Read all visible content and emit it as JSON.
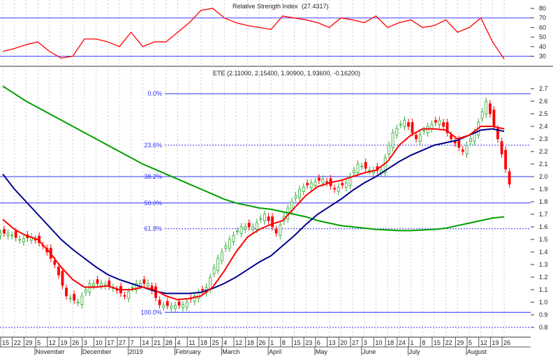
{
  "chart_data": [
    {
      "type": "line",
      "title": "Relative Strength Index",
      "title_value": "(27.4317)",
      "y_ticks": [
        30,
        40,
        50,
        60,
        70,
        80
      ],
      "ylim": [
        25,
        85
      ],
      "reference_lines": [
        70,
        30
      ],
      "color": "#ff0000",
      "values": [
        35,
        38,
        42,
        45,
        35,
        28,
        30,
        48,
        48,
        45,
        40,
        55,
        40,
        45,
        45,
        55,
        65,
        78,
        80,
        70,
        65,
        62,
        60,
        58,
        72,
        70,
        68,
        65,
        60,
        70,
        68,
        65,
        72,
        60,
        65,
        68,
        60,
        62,
        68,
        55,
        60,
        70,
        45,
        27
      ]
    },
    {
      "type": "candlestick",
      "title": "ETE (2.11000, 2.15400, 1.90900, 1.93600, -0.16200)",
      "ylim": [
        0.77,
        2.8
      ],
      "y_ticks": [
        "0.8",
        "0.9",
        "1.0",
        "1.1",
        "1.2",
        "1.3",
        "1.4",
        "1.5",
        "1.6",
        "1.7",
        "1.8",
        "1.9",
        "2.0",
        "2.1",
        "2.2",
        "2.3",
        "2.4",
        "2.5",
        "2.6",
        "2.7"
      ],
      "x_ticks": [
        "15",
        "22",
        "29",
        "5",
        "12",
        "19",
        "26",
        "3",
        "10",
        "17",
        "27",
        "7",
        "14",
        "21",
        "28",
        "4",
        "11",
        "18",
        "25",
        "4",
        "12",
        "18",
        "26",
        "1",
        "8",
        "15",
        "23",
        "6",
        "13",
        "20",
        "27",
        "3",
        "10",
        "18",
        "24",
        "1",
        "8",
        "15",
        "22",
        "29",
        "5",
        "12",
        "19",
        "26"
      ],
      "month_labels": [
        {
          "label": "November",
          "week": 3
        },
        {
          "label": "December",
          "week": 7
        },
        {
          "label": "2019",
          "week": 11
        },
        {
          "label": "February",
          "week": 15
        },
        {
          "label": "March",
          "week": 19
        },
        {
          "label": "April",
          "week": 23
        },
        {
          "label": "May",
          "week": 27
        },
        {
          "label": "June",
          "week": 31
        },
        {
          "label": "July",
          "week": 35
        },
        {
          "label": "August",
          "week": 40
        }
      ],
      "closes": [
        1.55,
        1.5,
        1.52,
        1.45,
        1.3,
        1.05,
        1.0,
        1.15,
        1.15,
        1.12,
        1.05,
        1.15,
        1.15,
        0.98,
        0.97,
        0.98,
        1.05,
        1.12,
        1.35,
        1.5,
        1.6,
        1.6,
        1.7,
        1.55,
        1.75,
        1.9,
        1.95,
        1.98,
        1.9,
        1.95,
        2.1,
        2.05,
        2.05,
        2.35,
        2.45,
        2.3,
        2.4,
        2.45,
        2.3,
        2.2,
        2.35,
        2.6,
        2.3,
        1.94
      ],
      "fibonacci": [
        {
          "label": "0.0%",
          "value": 2.66
        },
        {
          "label": "23.6%",
          "value": 2.25
        },
        {
          "label": "38.2%",
          "value": 2.0
        },
        {
          "label": "50.0%",
          "value": 1.79
        },
        {
          "label": "61.8%",
          "value": 1.585
        },
        {
          "label": "100.0%",
          "value": 0.92
        }
      ],
      "bottom_line": 0.8,
      "ma_series": [
        {
          "name": "MA long",
          "color": "#00a000",
          "values": [
            2.72,
            2.66,
            2.6,
            2.55,
            2.5,
            2.45,
            2.4,
            2.35,
            2.3,
            2.25,
            2.2,
            2.15,
            2.1,
            2.06,
            2.02,
            1.98,
            1.94,
            1.9,
            1.86,
            1.82,
            1.79,
            1.77,
            1.75,
            1.74,
            1.72,
            1.7,
            1.68,
            1.65,
            1.63,
            1.61,
            1.6,
            1.59,
            1.58,
            1.575,
            1.57,
            1.57,
            1.575,
            1.58,
            1.59,
            1.61,
            1.63,
            1.65,
            1.67,
            1.68
          ]
        },
        {
          "name": "MA medium",
          "color": "#00008b",
          "values": [
            2.02,
            1.9,
            1.8,
            1.7,
            1.6,
            1.5,
            1.42,
            1.35,
            1.28,
            1.22,
            1.18,
            1.15,
            1.12,
            1.09,
            1.07,
            1.07,
            1.07,
            1.08,
            1.11,
            1.15,
            1.2,
            1.26,
            1.32,
            1.37,
            1.45,
            1.53,
            1.62,
            1.7,
            1.76,
            1.82,
            1.89,
            1.95,
            2.0,
            2.06,
            2.12,
            2.17,
            2.21,
            2.25,
            2.27,
            2.29,
            2.33,
            2.37,
            2.38,
            2.36
          ]
        },
        {
          "name": "MA short",
          "color": "#ff0000",
          "values": [
            1.66,
            1.58,
            1.53,
            1.5,
            1.4,
            1.28,
            1.18,
            1.12,
            1.12,
            1.13,
            1.1,
            1.1,
            1.12,
            1.1,
            1.05,
            1.02,
            1.03,
            1.05,
            1.12,
            1.25,
            1.4,
            1.52,
            1.58,
            1.62,
            1.65,
            1.75,
            1.85,
            1.92,
            1.95,
            1.97,
            2.0,
            2.03,
            2.05,
            2.12,
            2.25,
            2.33,
            2.38,
            2.38,
            2.37,
            2.3,
            2.33,
            2.4,
            2.4,
            2.38
          ]
        }
      ]
    }
  ]
}
